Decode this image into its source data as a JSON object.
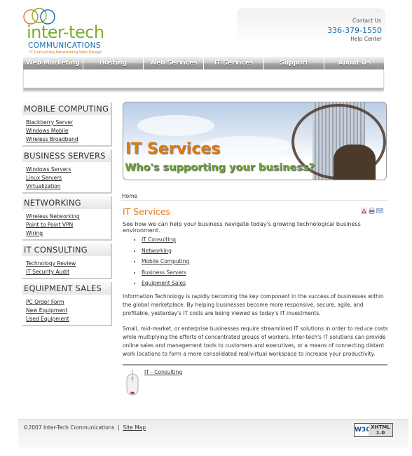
{
  "logo": {
    "word": "inter-tech",
    "communications": "COMMUNICATIONS",
    "tagline": "IT Consulting Networking Web Design"
  },
  "contact": {
    "contact_us": "Contact Us",
    "phone": "336-379-1550",
    "help_center": "Help Center"
  },
  "nav": [
    "Web Marketing",
    "Hosting",
    "Web Services",
    "IT Services",
    "Support",
    "About Us"
  ],
  "sidebar": [
    {
      "title": "MOBILE COMPUTING",
      "items": [
        "Blackberry Server",
        "Windows Mobile",
        "Wireless Broadband"
      ]
    },
    {
      "title": "BUSINESS SERVERS",
      "items": [
        "Windows Servers",
        "Linux Servers",
        "Virtualization"
      ]
    },
    {
      "title": "NETWORKING",
      "items": [
        "Wireless Networking",
        "Point to Point VPN",
        "Wiring"
      ]
    },
    {
      "title": "IT CONSULTING",
      "items": [
        "Technology Review",
        "IT Security Audit"
      ]
    },
    {
      "title": "EQUIPMENT SALES",
      "items": [
        "PC Order Form",
        "New Equipment",
        "Used Equipment"
      ]
    }
  ],
  "banner": {
    "title": "IT Services",
    "subtitle": "Who's supporting your business?"
  },
  "breadcrumb": "Home",
  "main": {
    "title": "IT Services",
    "intro": "See how we can help your business navigate today's growing technological business environment.",
    "services": [
      "IT Consulting",
      "Networking",
      "Mobile Computing",
      "Business Servers",
      "Equipment Sales"
    ],
    "para1": "Information Technology is rapidly becoming the key component in the success of businesses within the global marketplace. By helping businesses become more responsive, secure, agile, and profitable, yesterday's IT costs are being viewed as today's IT investments.",
    "para2": "Small, mid-market, or enterprise businesses require streamlined IT solutions in order to reduce costs while multiplying the efforts of concentrated groups of workers. Inter-tech's IT solutions can provide online sales and management tools to customers and executives, or a means of connecting distant work locations to form a more consolidated real/virtual workspace to increase your productivity.",
    "next_link": "IT - Consulting"
  },
  "footer": {
    "copyright": "©2007 Inter-Tech Communications",
    "separator": "|",
    "site_map": "Site Map",
    "badge_w3c": "W3C",
    "badge_xhtml": "XHTML",
    "badge_version": "1.0"
  },
  "colors": {
    "orange": "#e07a12",
    "green": "#7aad2b",
    "blue": "#0f6dab"
  }
}
